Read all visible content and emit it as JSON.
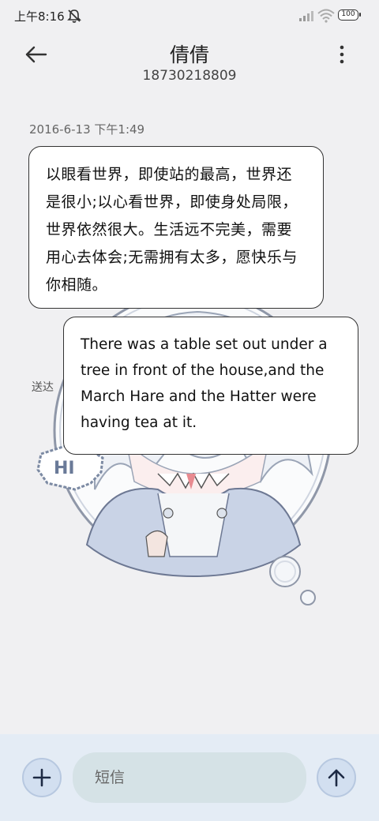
{
  "status_bar": {
    "time": "上午8:16",
    "battery": "100",
    "icons": [
      "mute-icon",
      "signal-icon",
      "wifi-icon",
      "battery-icon"
    ]
  },
  "header": {
    "contact_name": "倩倩",
    "phone_number": "18730218809",
    "back_icon": "back-arrow-icon",
    "more_icon": "more-vertical-icon"
  },
  "conversation": {
    "timestamp": "2016-6-13 下午1:49",
    "delivery_status": "送达",
    "messages": [
      {
        "lang": "zh",
        "text": "以眼看世界，即使站的最高，世界还是很小;以心看世界，即使身处局限，世界依然很大。生活远不完美，需要用心去体会;无需拥有太多，愿快乐与你相随。"
      },
      {
        "lang": "en",
        "text": "There was a table set out under a tree in front of the house,and the March Hare and the Hatter were having tea at it."
      }
    ]
  },
  "composer": {
    "placeholder": "短信",
    "add_icon": "plus-icon",
    "send_icon": "send-arrow-icon"
  },
  "colors": {
    "background": "#f0f0f2",
    "composer_bg": "#e4ecf5",
    "input_bg": "#d5e2e6",
    "button_bg": "#d2dff0"
  }
}
